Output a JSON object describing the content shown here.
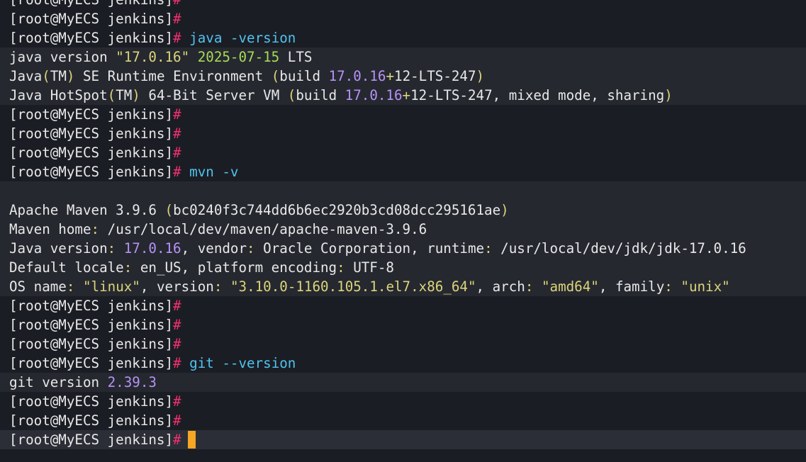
{
  "colors": {
    "background": "#1b1d24",
    "text": "#e8e8e8",
    "prompt_hash": "#f0306e",
    "command": "#4fc3ee",
    "string": "#dcd57a",
    "version_green": "#a6dc55",
    "number": "#b693f6",
    "cursor": "#f5a623"
  },
  "lines": [
    {
      "hl": false,
      "segs": [
        [
          "w",
          "[root@MyECS jenkins]"
        ],
        [
          "r",
          "#"
        ]
      ]
    },
    {
      "hl": false,
      "segs": [
        [
          "w",
          "[root@MyECS jenkins]"
        ],
        [
          "r",
          "#"
        ]
      ]
    },
    {
      "hl": false,
      "segs": [
        [
          "w",
          "[root@MyECS jenkins]"
        ],
        [
          "r",
          "#"
        ],
        [
          "w",
          " "
        ],
        [
          "c",
          "java -version"
        ]
      ]
    },
    {
      "hl": true,
      "segs": [
        [
          "w",
          "java version "
        ],
        [
          "y",
          "\"17.0.16\""
        ],
        [
          "w",
          " "
        ],
        [
          "g",
          "2025-07-15"
        ],
        [
          "w",
          " LTS"
        ]
      ]
    },
    {
      "hl": true,
      "segs": [
        [
          "w",
          "Java"
        ],
        [
          "y",
          "("
        ],
        [
          "w",
          "TM"
        ],
        [
          "y",
          ")"
        ],
        [
          "w",
          " SE Runtime Environment "
        ],
        [
          "y",
          "("
        ],
        [
          "w",
          "build "
        ],
        [
          "p",
          "17.0.16"
        ],
        [
          "y",
          "+"
        ],
        [
          "w",
          "12-LTS-247"
        ],
        [
          "y",
          ")"
        ]
      ]
    },
    {
      "hl": true,
      "segs": [
        [
          "w",
          "Java HotSpot"
        ],
        [
          "y",
          "("
        ],
        [
          "w",
          "TM"
        ],
        [
          "y",
          ")"
        ],
        [
          "w",
          " 64-Bit Server VM "
        ],
        [
          "y",
          "("
        ],
        [
          "w",
          "build "
        ],
        [
          "p",
          "17.0.16"
        ],
        [
          "y",
          "+"
        ],
        [
          "w",
          "12-LTS-247, mixed mode, sharing"
        ],
        [
          "y",
          ")"
        ]
      ]
    },
    {
      "hl": false,
      "segs": [
        [
          "w",
          "[root@MyECS jenkins]"
        ],
        [
          "r",
          "#"
        ]
      ]
    },
    {
      "hl": false,
      "segs": [
        [
          "w",
          "[root@MyECS jenkins]"
        ],
        [
          "r",
          "#"
        ]
      ]
    },
    {
      "hl": false,
      "segs": [
        [
          "w",
          "[root@MyECS jenkins]"
        ],
        [
          "r",
          "#"
        ]
      ]
    },
    {
      "hl": false,
      "segs": [
        [
          "w",
          "[root@MyECS jenkins]"
        ],
        [
          "r",
          "#"
        ],
        [
          "w",
          " "
        ],
        [
          "c",
          "mvn -v"
        ]
      ]
    },
    {
      "hl": true,
      "segs": []
    },
    {
      "hl": true,
      "segs": [
        [
          "w",
          "Apache Maven 3.9.6 "
        ],
        [
          "y",
          "("
        ],
        [
          "w",
          "bc0240f3c744dd6b6ec2920b3cd08dcc295161ae"
        ],
        [
          "y",
          ")"
        ]
      ]
    },
    {
      "hl": true,
      "segs": [
        [
          "w",
          "Maven home"
        ],
        [
          "y",
          ":"
        ],
        [
          "w",
          " /usr/local/dev/maven/apache-maven-3.9.6"
        ]
      ]
    },
    {
      "hl": true,
      "segs": [
        [
          "w",
          "Java version"
        ],
        [
          "y",
          ":"
        ],
        [
          "w",
          " "
        ],
        [
          "p",
          "17.0.16"
        ],
        [
          "w",
          ", vendor"
        ],
        [
          "y",
          ":"
        ],
        [
          "w",
          " Oracle Corporation, runtime"
        ],
        [
          "y",
          ":"
        ],
        [
          "w",
          " /usr/local/dev/jdk/jdk-17.0.16"
        ]
      ]
    },
    {
      "hl": true,
      "segs": [
        [
          "w",
          "Default locale"
        ],
        [
          "y",
          ":"
        ],
        [
          "w",
          " en_US, platform encoding"
        ],
        [
          "y",
          ":"
        ],
        [
          "w",
          " UTF-8"
        ]
      ]
    },
    {
      "hl": true,
      "segs": [
        [
          "w",
          "OS name"
        ],
        [
          "y",
          ":"
        ],
        [
          "w",
          " "
        ],
        [
          "y",
          "\"linux\""
        ],
        [
          "w",
          ", version"
        ],
        [
          "y",
          ":"
        ],
        [
          "w",
          " "
        ],
        [
          "y",
          "\"3.10.0-1160.105.1.el7.x86_64\""
        ],
        [
          "w",
          ", arch"
        ],
        [
          "y",
          ":"
        ],
        [
          "w",
          " "
        ],
        [
          "y",
          "\"amd64\""
        ],
        [
          "w",
          ", family"
        ],
        [
          "y",
          ":"
        ],
        [
          "w",
          " "
        ],
        [
          "y",
          "\"unix\""
        ]
      ]
    },
    {
      "hl": false,
      "segs": [
        [
          "w",
          "[root@MyECS jenkins]"
        ],
        [
          "r",
          "#"
        ]
      ]
    },
    {
      "hl": false,
      "segs": [
        [
          "w",
          "[root@MyECS jenkins]"
        ],
        [
          "r",
          "#"
        ]
      ]
    },
    {
      "hl": false,
      "segs": [
        [
          "w",
          "[root@MyECS jenkins]"
        ],
        [
          "r",
          "#"
        ]
      ]
    },
    {
      "hl": false,
      "segs": [
        [
          "w",
          "[root@MyECS jenkins]"
        ],
        [
          "r",
          "#"
        ],
        [
          "w",
          " "
        ],
        [
          "c",
          "git --version"
        ]
      ]
    },
    {
      "hl": true,
      "segs": [
        [
          "w",
          "git version "
        ],
        [
          "p",
          "2.39.3"
        ]
      ]
    },
    {
      "hl": false,
      "segs": [
        [
          "w",
          "[root@MyECS jenkins]"
        ],
        [
          "r",
          "#"
        ]
      ]
    },
    {
      "hl": false,
      "segs": [
        [
          "w",
          "[root@MyECS jenkins]"
        ],
        [
          "r",
          "#"
        ]
      ]
    },
    {
      "hl": false,
      "cursor": true,
      "segs": [
        [
          "w",
          "[root@MyECS jenkins]"
        ],
        [
          "r",
          "#"
        ]
      ]
    }
  ]
}
